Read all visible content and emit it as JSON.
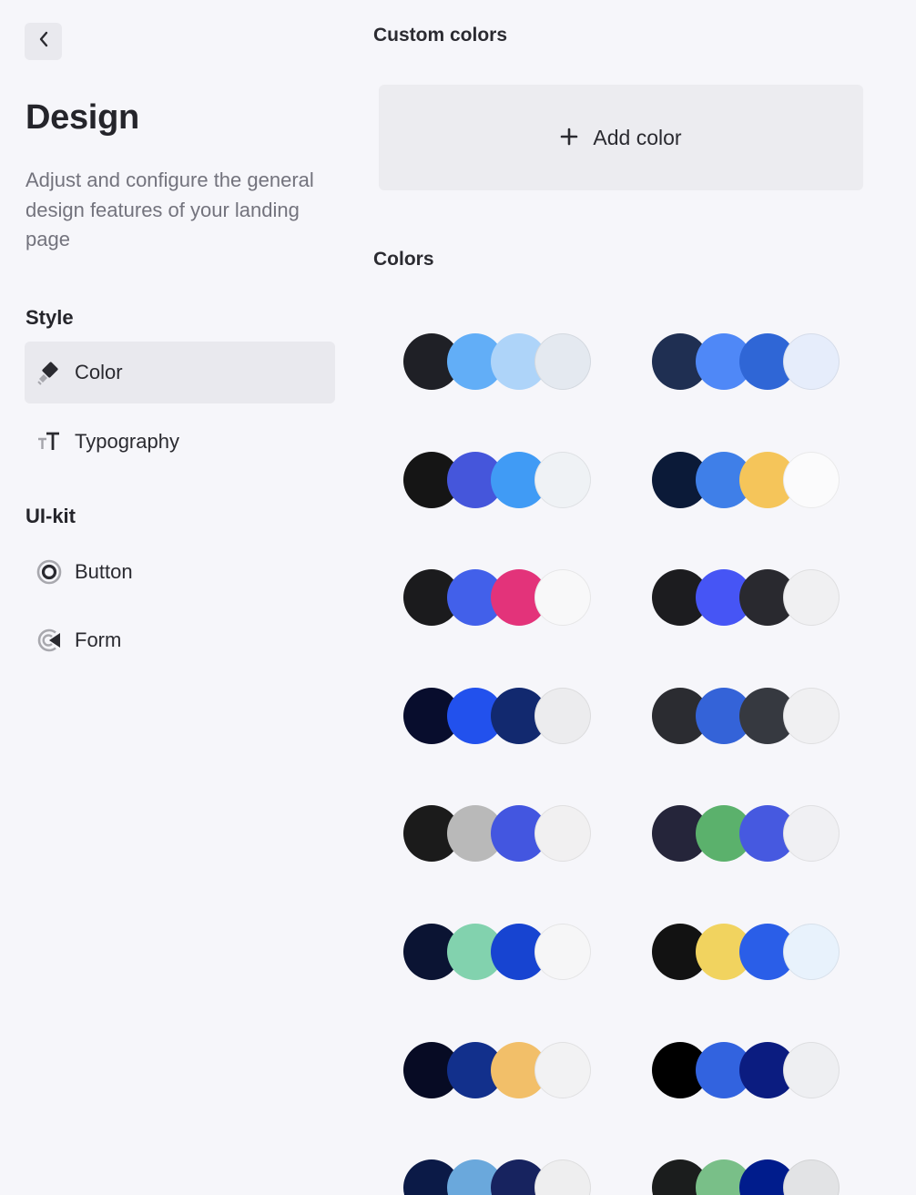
{
  "sidebar": {
    "title": "Design",
    "description": "Adjust and configure the general design features of your landing page",
    "sections": [
      {
        "label": "Style",
        "items": [
          {
            "label": "Color",
            "icon": "paint-brush-icon",
            "active": true
          },
          {
            "label": "Typography",
            "icon": "text-size-icon",
            "active": false
          }
        ]
      },
      {
        "label": "UI-kit",
        "items": [
          {
            "label": "Button",
            "icon": "radio-button-icon",
            "active": false
          },
          {
            "label": "Form",
            "icon": "form-icon",
            "active": false
          }
        ]
      }
    ]
  },
  "custom_colors": {
    "heading": "Custom colors",
    "add_label": "Add color",
    "add_icon": "plus-icon"
  },
  "colors": {
    "heading": "Colors",
    "palettes": [
      [
        "#1f2026",
        "#62aef7",
        "#aed4f9",
        "#e4e9f0"
      ],
      [
        "#1f2f52",
        "#4f88f7",
        "#2f66d6",
        "#e6edfb"
      ],
      [
        "#151515",
        "#4556db",
        "#409bf5",
        "#eff2f5"
      ],
      [
        "#0b1a38",
        "#3f7fe8",
        "#f5c55a",
        "#fbfbfc"
      ],
      [
        "#1b1b1d",
        "#4260ea",
        "#e3337a",
        "#f8f8f9"
      ],
      [
        "#1c1c1f",
        "#4655f5",
        "#29292f",
        "#f0f0f2"
      ],
      [
        "#080d2d",
        "#2251ed",
        "#12296f",
        "#ececee"
      ],
      [
        "#2b2c31",
        "#3463d8",
        "#363940",
        "#f0f0f2"
      ],
      [
        "#1b1b1b",
        "#b9b9b9",
        "#4356e0",
        "#f1f0f1"
      ],
      [
        "#25253a",
        "#5bb16c",
        "#4659e0",
        "#f0f0f3"
      ],
      [
        "#0b1433",
        "#82d2ae",
        "#1744d1",
        "#f6f6f7"
      ],
      [
        "#121212",
        "#f1d35f",
        "#2a5ee8",
        "#e8f2fc"
      ],
      [
        "#070b24",
        "#12308c",
        "#f2bf69",
        "#f2f2f3"
      ],
      [
        "#000000",
        "#3263df",
        "#0b1c80",
        "#eeeff2"
      ],
      [
        "#0b1a47",
        "#6aa8dc",
        "#17235f",
        "#eeeeef"
      ],
      [
        "#1b1d1d",
        "#79bf88",
        "#001c8c",
        "#e2e3e5"
      ]
    ]
  }
}
